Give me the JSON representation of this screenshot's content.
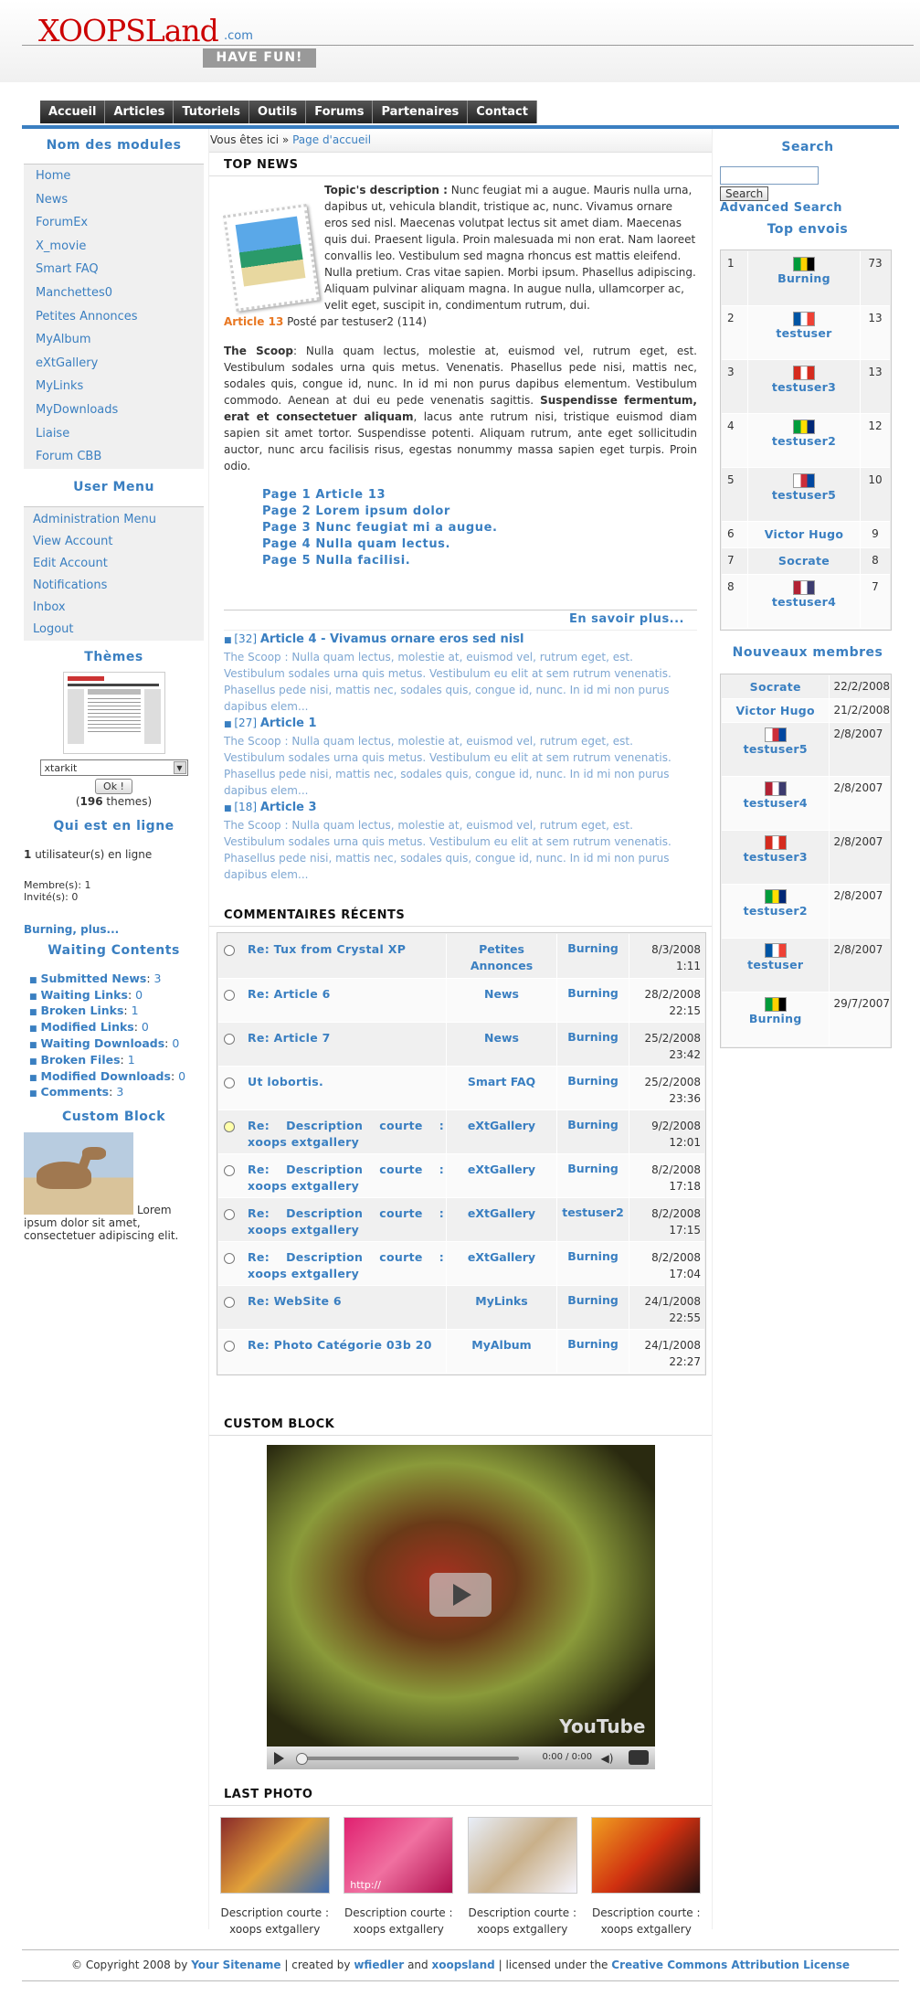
{
  "header": {
    "logo_main": "XOOPSLand",
    "logo_suffix": ".com",
    "slogan": "HAVE FUN!"
  },
  "nav": [
    "Accueil",
    "Articles",
    "Tutoriels",
    "Outils",
    "Forums",
    "Partenaires",
    "Contact"
  ],
  "left": {
    "modules_title": "Nom des modules",
    "modules": [
      "Home",
      "News",
      "ForumEx",
      "X_movie",
      "Smart FAQ",
      "Manchettes0",
      "Petites Annonces",
      "MyAlbum",
      "eXtGallery",
      "MyLinks",
      "MyDownloads",
      "Liaise",
      "Forum CBB"
    ],
    "usermenu_title": "User Menu",
    "usermenu": [
      "Administration Menu",
      "View Account",
      "Edit Account",
      "Notifications",
      "Inbox",
      "Logout"
    ],
    "themes_title": "Thèmes",
    "theme_selected": "xtarkit",
    "theme_ok": "Ok !",
    "theme_count": "196",
    "theme_count_suffix": "themes",
    "online_title": "Qui est en ligne",
    "online_count": "1",
    "online_text": "utilisateur(s) en ligne",
    "members_line": "Membre(s): 1",
    "guests_line": "Invité(s): 0",
    "online_users": "Burning, plus...",
    "waiting_title": "Waiting Contents",
    "waiting": [
      {
        "label": "Submitted News",
        "count": "3"
      },
      {
        "label": "Waiting Links",
        "count": "0"
      },
      {
        "label": "Broken Links",
        "count": "1"
      },
      {
        "label": "Modified Links",
        "count": "0"
      },
      {
        "label": "Waiting Downloads",
        "count": "0"
      },
      {
        "label": "Broken Files",
        "count": "1"
      },
      {
        "label": "Modified Downloads",
        "count": "0"
      },
      {
        "label": "Comments",
        "count": "3"
      }
    ],
    "custom_title": "Custom Block",
    "custom_text": "Lorem ipsum dolor sit amet, consectetuer adipiscing elit."
  },
  "center": {
    "breadcrumb_prefix": "Vous êtes ici »",
    "breadcrumb_link": "Page d'accueil",
    "topnews_title": "TOP NEWS",
    "topic_label": "Topic's description :",
    "topic_text": "Nunc feugiat mi a augue. Mauris nulla urna, dapibus ut, vehicula blandit, tristique ac, nunc. Vivamus ornare eros sed nisl. Maecenas volutpat lectus sit amet diam. Maecenas quis dui. Praesent ligula. Proin malesuada mi non erat. Nam laoreet convallis leo. Vestibulum sed magna rhoncus est mattis eleifend. Nulla pretium. Cras vitae sapien. Morbi ipsum. Phasellus adipiscing. Aliquam pulvinar aliquam magna. In augue nulla, ullamcorper ac, velit eget, suscipit in, condimentum rutrum, dui.",
    "article_label": "Article 13",
    "posted_by": "Posté par testuser2 (114)",
    "scoop_label": "The Scoop",
    "scoop_text1": ": Nulla quam lectus, molestie at, euismod vel, rutrum eget, est. Vestibulum sodales urna quis metus. Venenatis. Phasellus pede nisi, mattis nec, sodales quis, congue id, nunc. In id mi non purus dapibus elementum. Vestibulum commodo. Aenean at dui eu pede venenatis sagittis.",
    "scoop_bold": "Suspendisse fermentum, erat et consectetuer aliquam",
    "scoop_text2": ", lacus ante rutrum nisi, tristique euismod diam sapien sit amet tortor. Suspendisse potenti. Aliquam rutrum, ante eget sollicitudin auctor, nunc arcu facilisis risus, egestas nonummy massa sapien eget turpis. Proin odio.",
    "pages": [
      "Page 1 Article 13",
      "Page 2 Lorem ipsum dolor",
      "Page 3 Nunc feugiat mi a augue.",
      "Page 4 Nulla quam lectus.",
      "Page 5 Nulla facilisi."
    ],
    "more": "En savoir plus...",
    "news": [
      {
        "count": "[32]",
        "title": "Article 4 - Vivamus ornare eros sed nisl",
        "text": "The Scoop : Nulla quam lectus, molestie at, euismod vel, rutrum eget, est. Vestibulum sodales urna quis metus. Vestibulum eu elit at sem rutrum venenatis. Phasellus pede nisi, mattis nec, sodales quis, congue id, nunc. In id mi non purus dapibus elem..."
      },
      {
        "count": "[27]",
        "title": "Article 1",
        "text": "The Scoop : Nulla quam lectus, molestie at, euismod vel, rutrum eget, est. Vestibulum sodales urna quis metus. Vestibulum eu elit at sem rutrum venenatis. Phasellus pede nisi, mattis nec, sodales quis, congue id, nunc. In id mi non purus dapibus elem..."
      },
      {
        "count": "[18]",
        "title": "Article 3",
        "text": "The Scoop : Nulla quam lectus, molestie at, euismod vel, rutrum eget, est. Vestibulum sodales urna quis metus. Vestibulum eu elit at sem rutrum venenatis. Phasellus pede nisi, mattis nec, sodales quis, congue id, nunc. In id mi non purus dapibus elem..."
      }
    ],
    "comments_title": "COMMENTAIRES RÉCENTS",
    "comments": [
      {
        "title": "Re: Tux from Crystal XP",
        "module": "Petites Annonces",
        "user": "Burning",
        "date": "8/3/2008 1:11",
        "icon": "circle"
      },
      {
        "title": "Re: Article 6",
        "module": "News",
        "user": "Burning",
        "date": "28/2/2008 22:15",
        "icon": "circle"
      },
      {
        "title": "Re: Article 7",
        "module": "News",
        "user": "Burning",
        "date": "25/2/2008 23:42",
        "icon": "circle"
      },
      {
        "title": "Ut lobortis.",
        "module": "Smart FAQ",
        "user": "Burning",
        "date": "25/2/2008 23:36",
        "icon": "circle"
      },
      {
        "title": "Re: Description courte : xoops extgallery",
        "module": "eXtGallery",
        "user": "Burning",
        "date": "9/2/2008 12:01",
        "icon": "smile"
      },
      {
        "title": "Re: Description courte : xoops extgallery",
        "module": "eXtGallery",
        "user": "Burning",
        "date": "8/2/2008 17:18",
        "icon": "circle"
      },
      {
        "title": "Re: Description courte : xoops extgallery",
        "module": "eXtGallery",
        "user": "testuser2",
        "date": "8/2/2008 17:15",
        "icon": "circle"
      },
      {
        "title": "Re: Description courte : xoops extgallery",
        "module": "eXtGallery",
        "user": "Burning",
        "date": "8/2/2008 17:04",
        "icon": "circle"
      },
      {
        "title": "Re: WebSite 6",
        "module": "MyLinks",
        "user": "Burning",
        "date": "24/1/2008 22:55",
        "icon": "circle"
      },
      {
        "title": "Re: Photo Catégorie 03b 20",
        "module": "MyAlbum",
        "user": "Burning",
        "date": "24/1/2008 22:27",
        "icon": "circle"
      }
    ],
    "custom_title": "CUSTOM BLOCK",
    "video_time": "0:00 / 0:00",
    "video_brand": "YouTube",
    "photos_title": "LAST PHOTO",
    "photos": [
      {
        "caption": "Description courte : xoops extgallery",
        "colors": [
          "#8a2a2a",
          "#e2a23a",
          "#3a6ab0"
        ]
      },
      {
        "caption": "Description courte : xoops extgallery",
        "colors": [
          "#e02070",
          "#f070a0",
          "#b01050"
        ]
      },
      {
        "caption": "Description courte : xoops extgallery",
        "colors": [
          "#e8eef8",
          "#c9b08a",
          "#f6f6ff"
        ]
      },
      {
        "caption": "Description courte : xoops extgallery",
        "colors": [
          "#f0a020",
          "#d03010",
          "#201010"
        ]
      }
    ],
    "photo_watermark": "http://"
  },
  "right": {
    "search_title": "Search",
    "search_button": "Search",
    "advanced": "Advanced Search",
    "top_title": "Top envois",
    "top": [
      {
        "rank": "1",
        "name": "Burning",
        "count": "73",
        "flag": [
          "#009b3a",
          "#fed100",
          "#000000"
        ]
      },
      {
        "rank": "2",
        "name": "testuser",
        "count": "13",
        "flag": [
          "#0055a4",
          "#ffffff",
          "#ef4135"
        ]
      },
      {
        "rank": "3",
        "name": "testuser3",
        "count": "13",
        "flag": [
          "#d52b1e",
          "#ffffff",
          "#d52b1e"
        ]
      },
      {
        "rank": "4",
        "name": "testuser2",
        "count": "12",
        "flag": [
          "#009c3b",
          "#ffdf00",
          "#002776"
        ]
      },
      {
        "rank": "5",
        "name": "testuser5",
        "count": "10",
        "flag": [
          "#ffffff",
          "#cd2e3a",
          "#0047a0"
        ]
      },
      {
        "rank": "6",
        "name": "Victor Hugo",
        "count": "9",
        "flag": null
      },
      {
        "rank": "7",
        "name": "Socrate",
        "count": "8",
        "flag": null
      },
      {
        "rank": "8",
        "name": "testuser4",
        "count": "7",
        "flag": [
          "#b22234",
          "#ffffff",
          "#3c3b6e"
        ]
      }
    ],
    "new_title": "Nouveaux membres",
    "new_members": [
      {
        "name": "Socrate",
        "date": "22/2/2008",
        "flag": null
      },
      {
        "name": "Victor Hugo",
        "date": "21/2/2008",
        "flag": null
      },
      {
        "name": "testuser5",
        "date": "2/8/2007",
        "flag": [
          "#ffffff",
          "#cd2e3a",
          "#0047a0"
        ]
      },
      {
        "name": "testuser4",
        "date": "2/8/2007",
        "flag": [
          "#b22234",
          "#ffffff",
          "#3c3b6e"
        ]
      },
      {
        "name": "testuser3",
        "date": "2/8/2007",
        "flag": [
          "#d52b1e",
          "#ffffff",
          "#d52b1e"
        ]
      },
      {
        "name": "testuser2",
        "date": "2/8/2007",
        "flag": [
          "#009c3b",
          "#ffdf00",
          "#002776"
        ]
      },
      {
        "name": "testuser",
        "date": "2/8/2007",
        "flag": [
          "#0055a4",
          "#ffffff",
          "#ef4135"
        ]
      },
      {
        "name": "Burning",
        "date": "29/7/2007",
        "flag": [
          "#009b3a",
          "#fed100",
          "#000000"
        ]
      }
    ]
  },
  "footer": {
    "copyright": "© Copyright 2008 by",
    "sitename": "Your Sitename",
    "created": "| created by",
    "author1": "wfiedler",
    "and": "and",
    "author2": "xoopsland",
    "licensed": "| licensed under the",
    "license": "Creative Commons Attribution License"
  },
  "colors": {
    "accent": "#3a7fc1",
    "logo": "#cc0000",
    "article": "#e87722"
  }
}
